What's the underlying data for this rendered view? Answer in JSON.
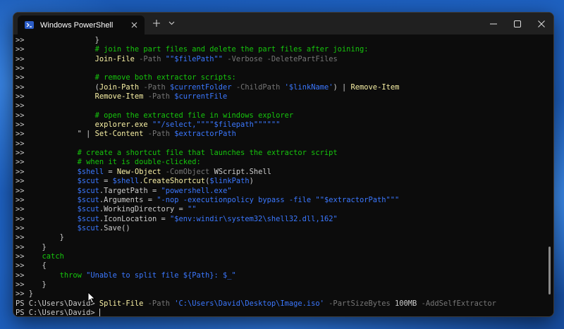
{
  "window": {
    "tab_title": "Windows PowerShell",
    "tab_icon": "powershell-icon",
    "new_tab_icon": "plus-icon",
    "dropdown_icon": "chevron-down-icon",
    "controls": [
      "minimize-icon",
      "maximize-icon",
      "close-icon"
    ]
  },
  "colors": {
    "background": "#0c0c0c",
    "text": "#cccccc",
    "comment": "#16c60c",
    "string": "#3b78ff",
    "variable": "#3b78ff",
    "command": "#f9f1a5",
    "parameter": "#767676",
    "keyword": "#16c60c",
    "operator": "#767676",
    "titlebar": "#202020"
  },
  "terminal": {
    "lines": [
      [
        {
          "t": ">>                "
        },
        {
          "t": "}",
          "c": "text"
        }
      ],
      [
        {
          "t": ">>                "
        },
        {
          "t": "# join the part files and delete the part files after joining:",
          "c": "comment"
        }
      ],
      [
        {
          "t": ">>                "
        },
        {
          "t": "Join-File",
          "c": "command"
        },
        {
          "t": " -Path",
          "c": "parameter"
        },
        {
          "t": " \"\"$filePath\"\"",
          "c": "string"
        },
        {
          "t": " -Verbose",
          "c": "parameter"
        },
        {
          "t": " -DeletePartFiles",
          "c": "parameter"
        }
      ],
      [
        {
          "t": ">>"
        }
      ],
      [
        {
          "t": ">>                "
        },
        {
          "t": "# remove both extractor scripts:",
          "c": "comment"
        }
      ],
      [
        {
          "t": ">>                "
        },
        {
          "t": "(",
          "c": "text"
        },
        {
          "t": "Join-Path",
          "c": "command"
        },
        {
          "t": " -Path",
          "c": "parameter"
        },
        {
          "t": " $currentFolder",
          "c": "variable"
        },
        {
          "t": " -ChildPath",
          "c": "parameter"
        },
        {
          "t": " '",
          "c": "string"
        },
        {
          "t": "$linkName",
          "c": "variable"
        },
        {
          "t": "'",
          "c": "string"
        },
        {
          "t": ") | ",
          "c": "text"
        },
        {
          "t": "Remove-Item",
          "c": "command"
        }
      ],
      [
        {
          "t": ">>                "
        },
        {
          "t": "Remove-Item",
          "c": "command"
        },
        {
          "t": " -Path",
          "c": "parameter"
        },
        {
          "t": " $currentFile",
          "c": "variable"
        }
      ],
      [
        {
          "t": ">>"
        }
      ],
      [
        {
          "t": ">>                "
        },
        {
          "t": "# open the extracted file in windows explorer",
          "c": "comment"
        }
      ],
      [
        {
          "t": ">>                "
        },
        {
          "t": "explorer.exe",
          "c": "command"
        },
        {
          "t": " \"\"/select,\"\"\"\"$filepath\"\"\"\"\"\"",
          "c": "string"
        }
      ],
      [
        {
          "t": ">>            "
        },
        {
          "t": "\" | ",
          "c": "text"
        },
        {
          "t": "Set-Content",
          "c": "command"
        },
        {
          "t": " -Path",
          "c": "parameter"
        },
        {
          "t": " $extractorPath",
          "c": "variable"
        }
      ],
      [
        {
          "t": ">>"
        }
      ],
      [
        {
          "t": ">>            "
        },
        {
          "t": "# create a shortcut file that launches the extractor script",
          "c": "comment"
        }
      ],
      [
        {
          "t": ">>            "
        },
        {
          "t": "# when it is double-clicked:",
          "c": "comment"
        }
      ],
      [
        {
          "t": ">>            "
        },
        {
          "t": "$shell",
          "c": "variable"
        },
        {
          "t": " = ",
          "c": "text"
        },
        {
          "t": "New-Object",
          "c": "command"
        },
        {
          "t": " -ComObject",
          "c": "parameter"
        },
        {
          "t": " WScript.Shell",
          "c": "text"
        }
      ],
      [
        {
          "t": ">>            "
        },
        {
          "t": "$scut",
          "c": "variable"
        },
        {
          "t": " = ",
          "c": "text"
        },
        {
          "t": "$shell",
          "c": "variable"
        },
        {
          "t": ".",
          "c": "text"
        },
        {
          "t": "CreateShortcut",
          "c": "command"
        },
        {
          "t": "(",
          "c": "text"
        },
        {
          "t": "$linkPath",
          "c": "variable"
        },
        {
          "t": ")",
          "c": "text"
        }
      ],
      [
        {
          "t": ">>            "
        },
        {
          "t": "$scut",
          "c": "variable"
        },
        {
          "t": ".",
          "c": "text"
        },
        {
          "t": "TargetPath",
          "c": "text"
        },
        {
          "t": " = ",
          "c": "text"
        },
        {
          "t": "\"powershell.exe\"",
          "c": "string"
        }
      ],
      [
        {
          "t": ">>            "
        },
        {
          "t": "$scut",
          "c": "variable"
        },
        {
          "t": ".",
          "c": "text"
        },
        {
          "t": "Arguments",
          "c": "text"
        },
        {
          "t": " = ",
          "c": "text"
        },
        {
          "t": "\"-nop -executionpolicy bypass -file \"\"$extractorPath\"\"\"",
          "c": "string"
        }
      ],
      [
        {
          "t": ">>            "
        },
        {
          "t": "$scut",
          "c": "variable"
        },
        {
          "t": ".",
          "c": "text"
        },
        {
          "t": "WorkingDirectory",
          "c": "text"
        },
        {
          "t": " = ",
          "c": "text"
        },
        {
          "t": "\"\"",
          "c": "string"
        }
      ],
      [
        {
          "t": ">>            "
        },
        {
          "t": "$scut",
          "c": "variable"
        },
        {
          "t": ".",
          "c": "text"
        },
        {
          "t": "IconLocation",
          "c": "text"
        },
        {
          "t": " = ",
          "c": "text"
        },
        {
          "t": "\"$env:windir\\system32\\shell32.dll,162\"",
          "c": "string"
        }
      ],
      [
        {
          "t": ">>            "
        },
        {
          "t": "$scut",
          "c": "variable"
        },
        {
          "t": ".",
          "c": "text"
        },
        {
          "t": "Save",
          "c": "text"
        },
        {
          "t": "()",
          "c": "text"
        }
      ],
      [
        {
          "t": ">>        "
        },
        {
          "t": "}",
          "c": "text"
        }
      ],
      [
        {
          "t": ">>    "
        },
        {
          "t": "}",
          "c": "text"
        }
      ],
      [
        {
          "t": ">>    "
        },
        {
          "t": "catch",
          "c": "keyword"
        }
      ],
      [
        {
          "t": ">>    "
        },
        {
          "t": "{",
          "c": "text"
        }
      ],
      [
        {
          "t": ">>        "
        },
        {
          "t": "throw",
          "c": "keyword"
        },
        {
          "t": " \"Unable to split file ${Path}: $_\"",
          "c": "string"
        }
      ],
      [
        {
          "t": ">>    "
        },
        {
          "t": "}",
          "c": "text"
        }
      ],
      [
        {
          "t": ">> "
        },
        {
          "t": "}",
          "c": "text"
        }
      ],
      [
        {
          "t": "PS C:\\Users\\David> "
        },
        {
          "t": "Split-File",
          "c": "command"
        },
        {
          "t": " -Path",
          "c": "parameter"
        },
        {
          "t": " 'C:\\Users\\David\\Desktop\\Image.iso'",
          "c": "string"
        },
        {
          "t": " -PartSizeBytes",
          "c": "parameter"
        },
        {
          "t": " 100MB",
          "c": "text"
        },
        {
          "t": " -AddSelfExtractor",
          "c": "parameter"
        }
      ],
      [
        {
          "t": "PS C:\\Users\\David> "
        }
      ]
    ]
  }
}
